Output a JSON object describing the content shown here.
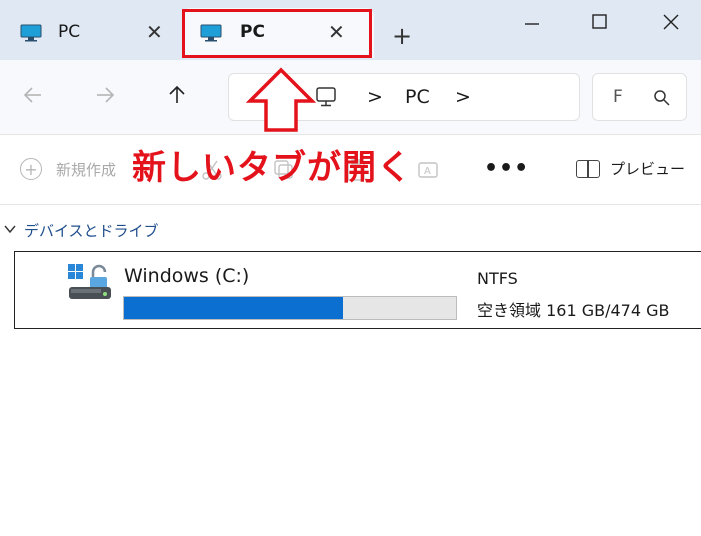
{
  "tabs": [
    {
      "label": "PC",
      "close": "✕"
    },
    {
      "label": "PC",
      "close": "✕"
    }
  ],
  "new_tab_label": "+",
  "window_controls": {
    "minimize": "minimize-icon",
    "maximize": "maximize-icon",
    "close": "close-icon"
  },
  "address": {
    "current": "PC",
    "separator": ">"
  },
  "search": {
    "placeholder": "F"
  },
  "annotation": "新しいタブが開く",
  "command_bar": {
    "new_label": "新規作成",
    "more_label": "•••",
    "preview_label": "プレビュー"
  },
  "section": {
    "title": "デバイスとドライブ"
  },
  "drive": {
    "name": "Windows (C:)",
    "filesystem": "NTFS",
    "free_text": "空き領域 161 GB/474 GB",
    "used_fraction": 0.66
  },
  "colors": {
    "accent": "#0a6fd0",
    "annotation": "#e3121b",
    "tab_strip": "#dfe8f3"
  }
}
